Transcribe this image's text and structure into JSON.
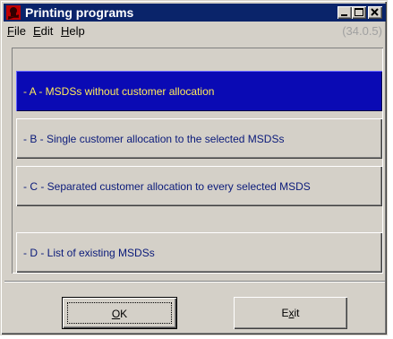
{
  "window": {
    "title": "Printing programs",
    "version": "(34.0.5)"
  },
  "menu": {
    "file": {
      "accel": "F",
      "rest": "ile"
    },
    "edit": {
      "accel": "E",
      "rest": "dit"
    },
    "help": {
      "accel": "H",
      "rest": "elp"
    }
  },
  "options": [
    {
      "label": "- A -   MSDSs without customer allocation",
      "selected": true
    },
    {
      "label": "- B -   Single customer allocation to the selected MSDSs",
      "selected": false
    },
    {
      "label": "- C -   Separated customer allocation to every selected MSDS",
      "selected": false
    },
    {
      "label": "- D -   List of existing MSDSs",
      "selected": false
    }
  ],
  "buttons": {
    "ok": {
      "accel": "O",
      "rest": "K"
    },
    "exit": {
      "pre": "E",
      "accel": "x",
      "rest": "it"
    }
  },
  "colors": {
    "titlebar": "#0a246a",
    "selected_bg": "#0a0ab4",
    "selected_text": "#ffeb5a",
    "option_text": "#0a1a7a",
    "face": "#d4d0c8"
  }
}
